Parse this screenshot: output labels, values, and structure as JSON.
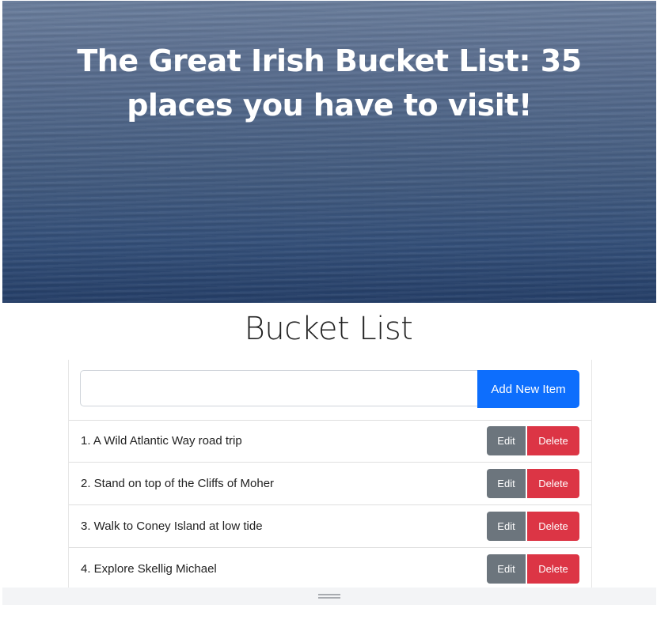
{
  "hero": {
    "title": "The Great Irish Bucket List: 35 places you have to visit!"
  },
  "page": {
    "heading": "Bucket List"
  },
  "add_form": {
    "input_value": "",
    "button_label": "Add New Item"
  },
  "items": [
    {
      "label": "1. A Wild Atlantic Way road trip",
      "edit_label": "Edit",
      "delete_label": "Delete"
    },
    {
      "label": "2. Stand on top of the Cliffs of Moher",
      "edit_label": "Edit",
      "delete_label": "Delete"
    },
    {
      "label": "3. Walk to Coney Island at low tide",
      "edit_label": "Edit",
      "delete_label": "Delete"
    },
    {
      "label": "4. Explore Skellig Michael",
      "edit_label": "Edit",
      "delete_label": "Delete"
    }
  ],
  "colors": {
    "primary": "#0d6efd",
    "secondary": "#6c757d",
    "danger": "#dc3545"
  },
  "icons": {
    "resize_handle": "drag-handle-icon"
  }
}
